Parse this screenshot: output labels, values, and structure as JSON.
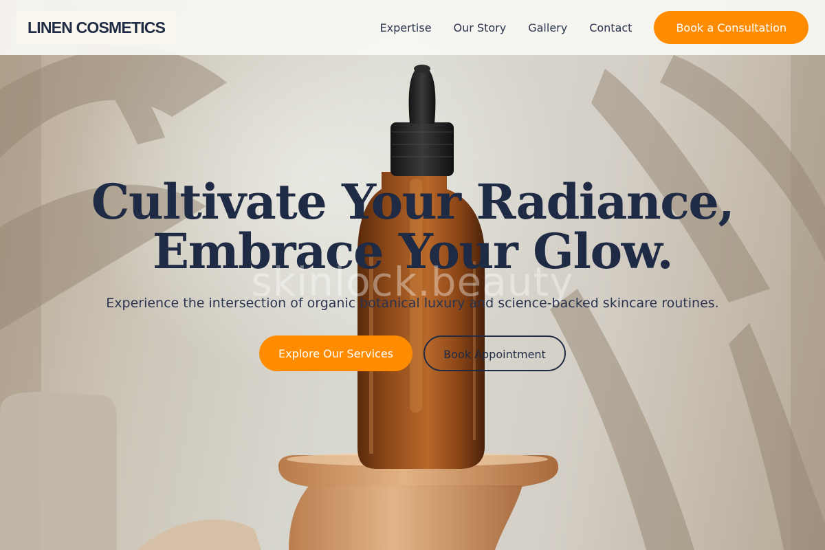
{
  "brand": {
    "name": "LINEN COSMETICS"
  },
  "nav": {
    "items": [
      {
        "label": "Expertise"
      },
      {
        "label": "Our Story"
      },
      {
        "label": "Gallery"
      },
      {
        "label": "Contact"
      }
    ],
    "cta_label": "Book a Consultation"
  },
  "hero": {
    "headline_line1": "Cultivate Your Radiance,",
    "headline_line2": "Embrace Your Glow.",
    "watermark": "skinlock.beauty",
    "subtitle": "Experience the intersection of organic botanical luxury and science-backed skincare routines.",
    "primary_button": "Explore Our Services",
    "secondary_button": "Book Appointment",
    "image": "amber dropper bottle on wooden pedestal with palm leaf shadows"
  },
  "colors": {
    "accent": "#ff8c00",
    "text_dark": "#1f2a44",
    "header_bg": "#f8f7f3"
  }
}
